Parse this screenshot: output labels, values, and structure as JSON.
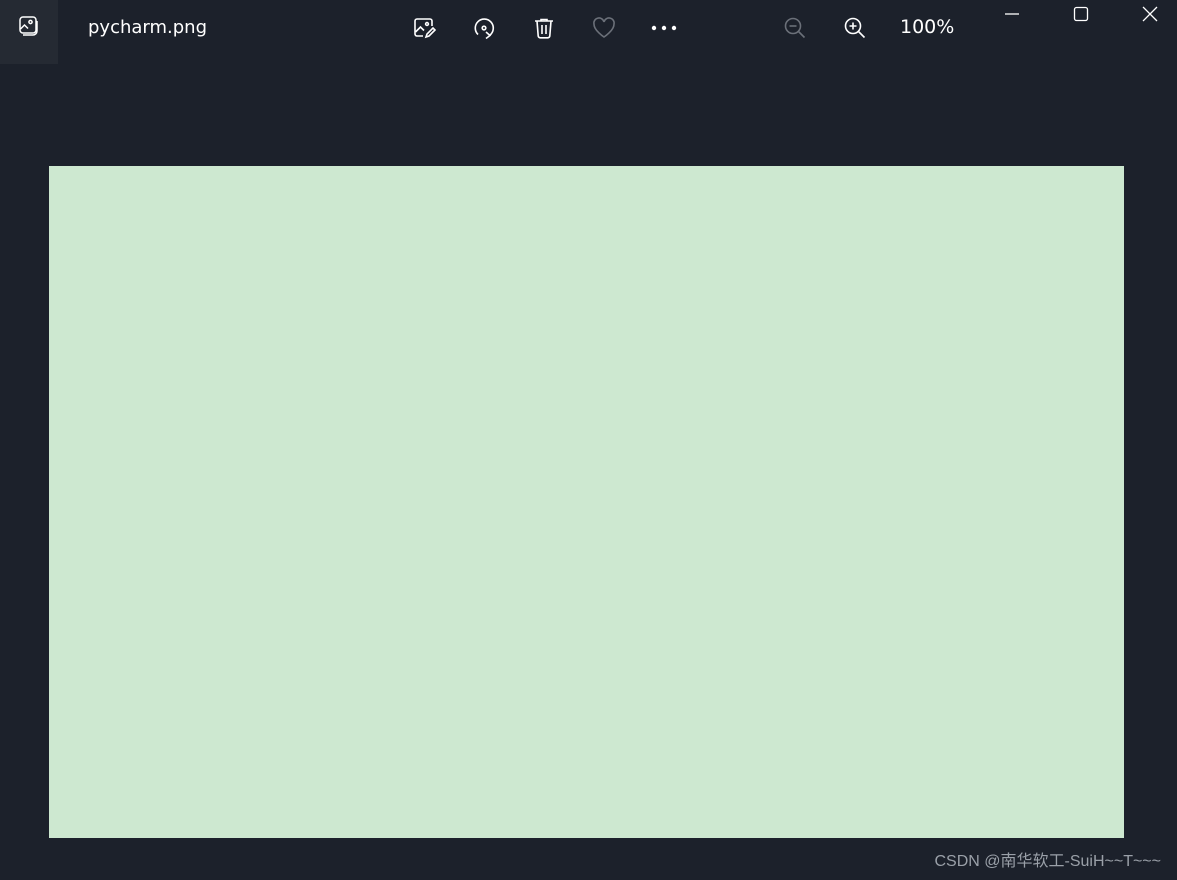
{
  "titlebar": {
    "app_icon": "photos-app-icon",
    "file_name": "pycharm.png",
    "tools": {
      "edit_icon": "edit-image-icon",
      "rotate_icon": "rotate-icon",
      "delete_icon": "trash-icon",
      "favorite_icon": "heart-icon",
      "more_icon": "more-icon"
    },
    "zoom": {
      "zoom_out_icon": "zoom-out-icon",
      "zoom_in_icon": "zoom-in-icon",
      "level": "100%"
    },
    "window_controls": {
      "minimize_icon": "minimize-icon",
      "maximize_icon": "maximize-icon",
      "close_icon": "close-icon"
    }
  },
  "viewer": {
    "image_color": "#cde8d0"
  },
  "watermark": "CSDN @南华软工-SuiH~~T~~~",
  "colors": {
    "background": "#1c212b",
    "disabled_icon": "#6b7079"
  }
}
